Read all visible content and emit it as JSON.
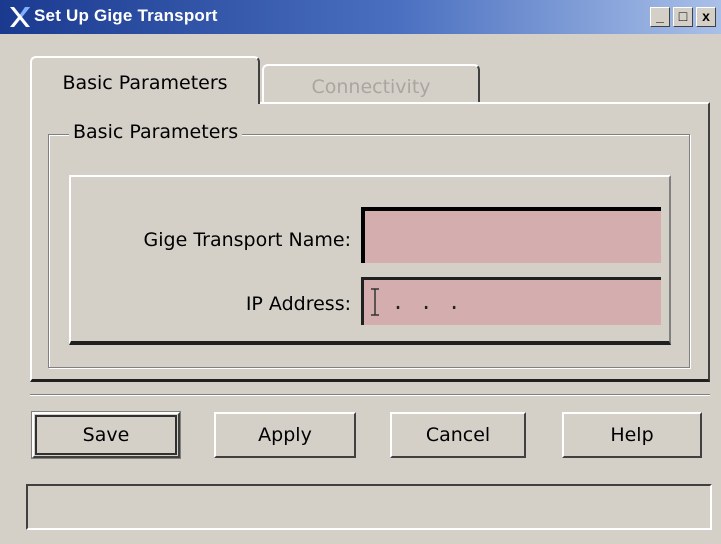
{
  "window": {
    "title": "Set Up Gige Transport",
    "controls": {
      "minimize": "_",
      "maximize": "□",
      "close": "x"
    },
    "icon": "x-logo-icon"
  },
  "tabs": [
    {
      "label": "Basic Parameters",
      "active": true
    },
    {
      "label": "Connectivity",
      "active": false
    }
  ],
  "group": {
    "title": "Basic Parameters",
    "fields": [
      {
        "label": "Gige Transport Name:",
        "value": "",
        "background": "#d4aeae"
      },
      {
        "label": "IP Address:",
        "value": ". . .",
        "background": "#d4aeae"
      }
    ]
  },
  "buttons": {
    "save": "Save",
    "apply": "Apply",
    "cancel": "Cancel",
    "help": "Help"
  },
  "status": {
    "text": ""
  },
  "colors": {
    "title_bar_start": "#1a3a8f",
    "title_bar_end": "#a9c0e8",
    "window_background": "#d4d0c8",
    "field_background": "#d4aeae"
  }
}
